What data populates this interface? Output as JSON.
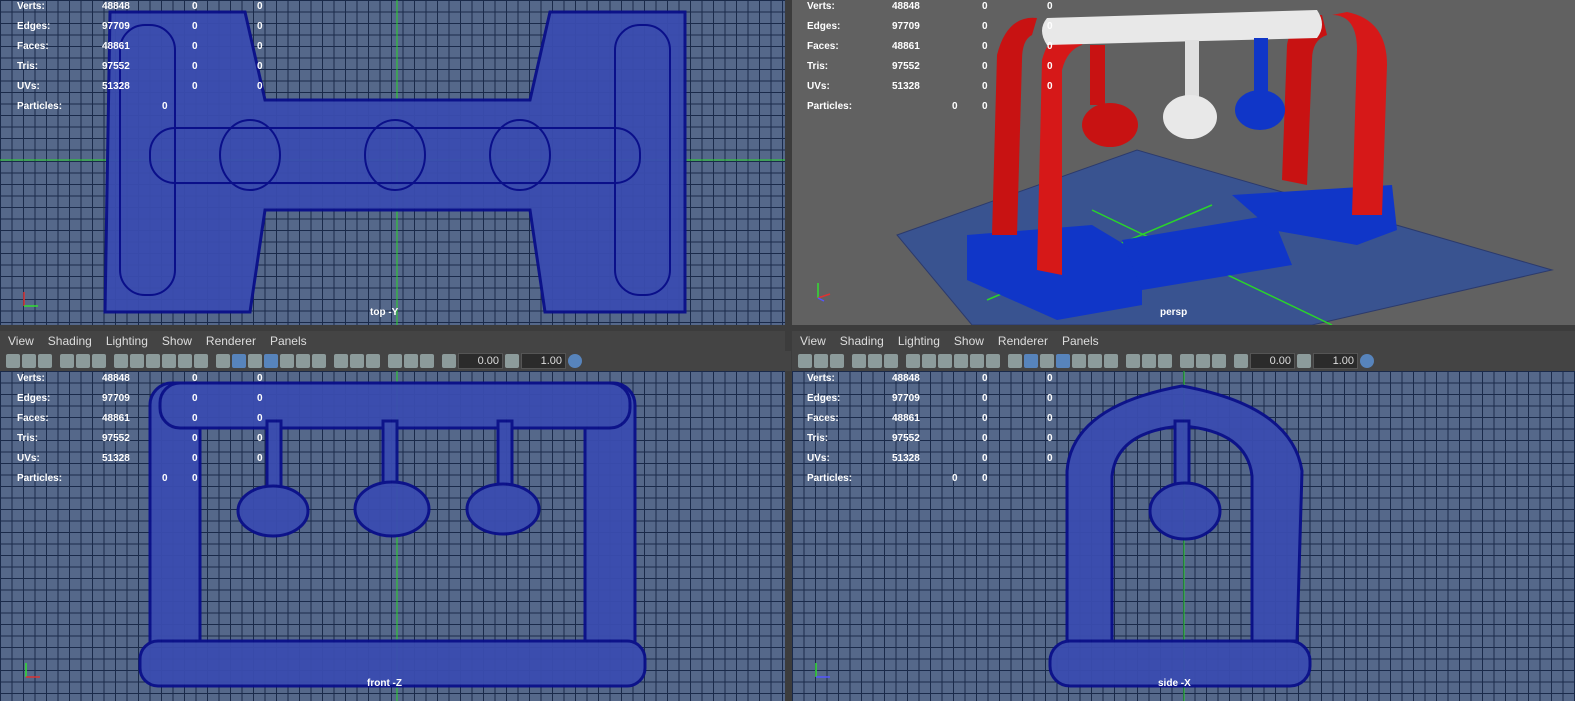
{
  "menu": {
    "view": "View",
    "shading": "Shading",
    "lighting": "Lighting",
    "show": "Show",
    "renderer": "Renderer",
    "panels": "Panels"
  },
  "toolbar": {
    "exposure": "0.00",
    "gamma": "1.00"
  },
  "hud_labels": {
    "verts": "Verts:",
    "edges": "Edges:",
    "faces": "Faces:",
    "tris": "Tris:",
    "uvs": "UVs:",
    "particles": "Particles:"
  },
  "stats": {
    "verts": "48848",
    "edges": "97709",
    "faces": "48861",
    "tris": "97552",
    "uvs": "51328",
    "zero": "0"
  },
  "viewports": {
    "top": "top -Y",
    "persp": "persp",
    "front": "front -Z",
    "side": "side -X"
  },
  "colors": {
    "wire": "#0a0f8a",
    "red": "#d01010",
    "blue": "#1036c8",
    "white": "#e8e8e8",
    "grid_bg": "#55688a"
  }
}
